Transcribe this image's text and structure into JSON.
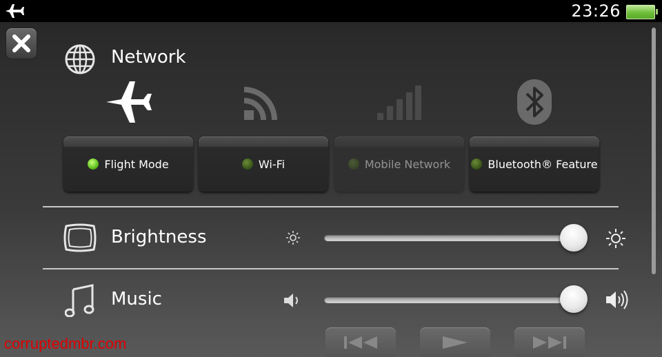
{
  "status_bar": {
    "time": "23:26"
  },
  "network": {
    "title": "Network",
    "toggles": [
      {
        "label": "Flight Mode",
        "state": "on"
      },
      {
        "label": "Wi-Fi",
        "state": "off"
      },
      {
        "label": "Mobile Network",
        "state": "disabled"
      },
      {
        "label": "Bluetooth® Feature",
        "state": "off"
      }
    ]
  },
  "brightness": {
    "label": "Brightness",
    "level": 1.0
  },
  "music": {
    "label": "Music",
    "volume": 1.0,
    "controls": [
      "previous-icon",
      "play-icon",
      "next-icon"
    ]
  },
  "watermark": "corruptedmbr.com",
  "colors": {
    "led_on": "#7ad12a",
    "watermark": "#e00000"
  }
}
